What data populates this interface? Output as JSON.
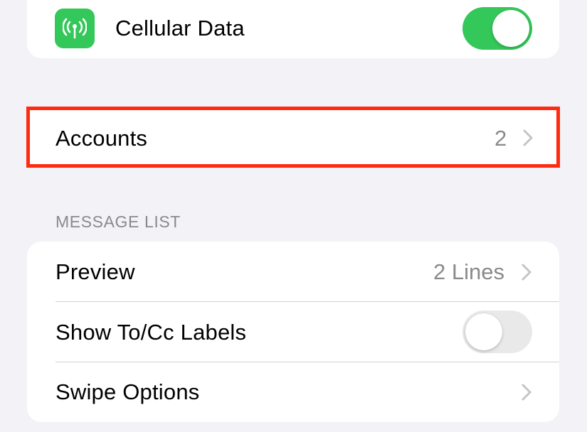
{
  "cellular": {
    "label": "Cellular Data",
    "icon": "antenna-icon",
    "icon_color": "#34c759",
    "toggle_on": true
  },
  "accounts": {
    "label": "Accounts",
    "value": "2",
    "highlight_color": "#ff2a12"
  },
  "message_list": {
    "header": "MESSAGE LIST",
    "preview": {
      "label": "Preview",
      "value": "2 Lines"
    },
    "show_tocc": {
      "label": "Show To/Cc Labels",
      "toggle_on": false
    },
    "swipe": {
      "label": "Swipe Options"
    }
  },
  "colors": {
    "background": "#f2f2f7",
    "toggle_on": "#34c759",
    "toggle_off": "#e9e9ea",
    "secondary_text": "#8a8a8e"
  }
}
